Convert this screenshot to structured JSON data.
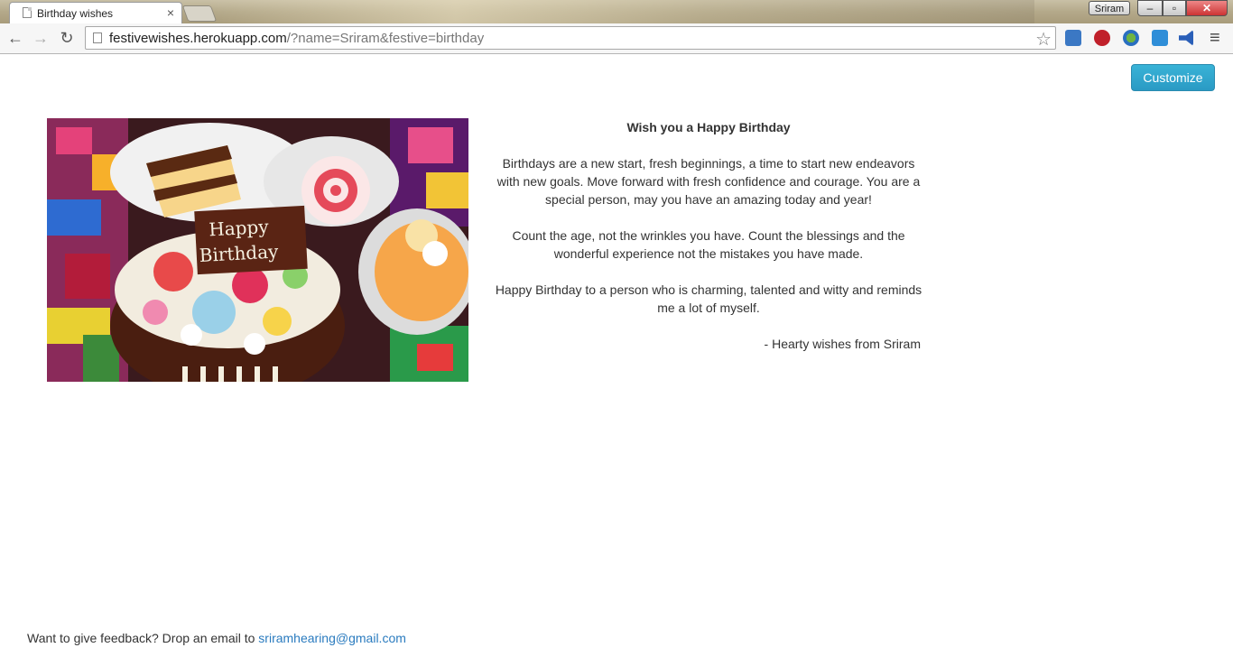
{
  "browser": {
    "tab_title": "Birthday wishes",
    "tab_close": "×",
    "profile_name": "Sriram",
    "win_min": "–",
    "win_max": "▫",
    "win_close": "✕",
    "url_host": "festivewishes.herokuapp.com",
    "url_rest": "/?name=Sriram&festive=birthday",
    "nav_back": "←",
    "nav_forward": "→",
    "nav_reload": "↻",
    "star": "☆",
    "menu": "≡",
    "extension_icons": [
      "screen-capture-icon",
      "adblock-icon",
      "earth-icon",
      "cast-icon",
      "announce-icon"
    ]
  },
  "page": {
    "customize_label": "Customize",
    "image_alt_text": "Happy Birthday",
    "wish_title": "Wish you a Happy Birthday",
    "paragraphs": [
      "Birthdays are a new start, fresh beginnings, a time to start new endeavors with new goals. Move forward with fresh confidence and courage. You are a special person, may you have an amazing today and year!",
      "Count the age, not the wrinkles you have. Count the blessings and the wonderful experience not the mistakes you have made.",
      "Happy Birthday to a person who is charming, talented and witty and reminds me a lot of myself."
    ],
    "signature": "- Hearty wishes from Sriram",
    "feedback_text": "Want to give feedback? Drop an email to",
    "feedback_email": "sriramhearing@gmail.com",
    "accent_color": "#2a9ac4",
    "link_color": "#2a7bbf"
  }
}
